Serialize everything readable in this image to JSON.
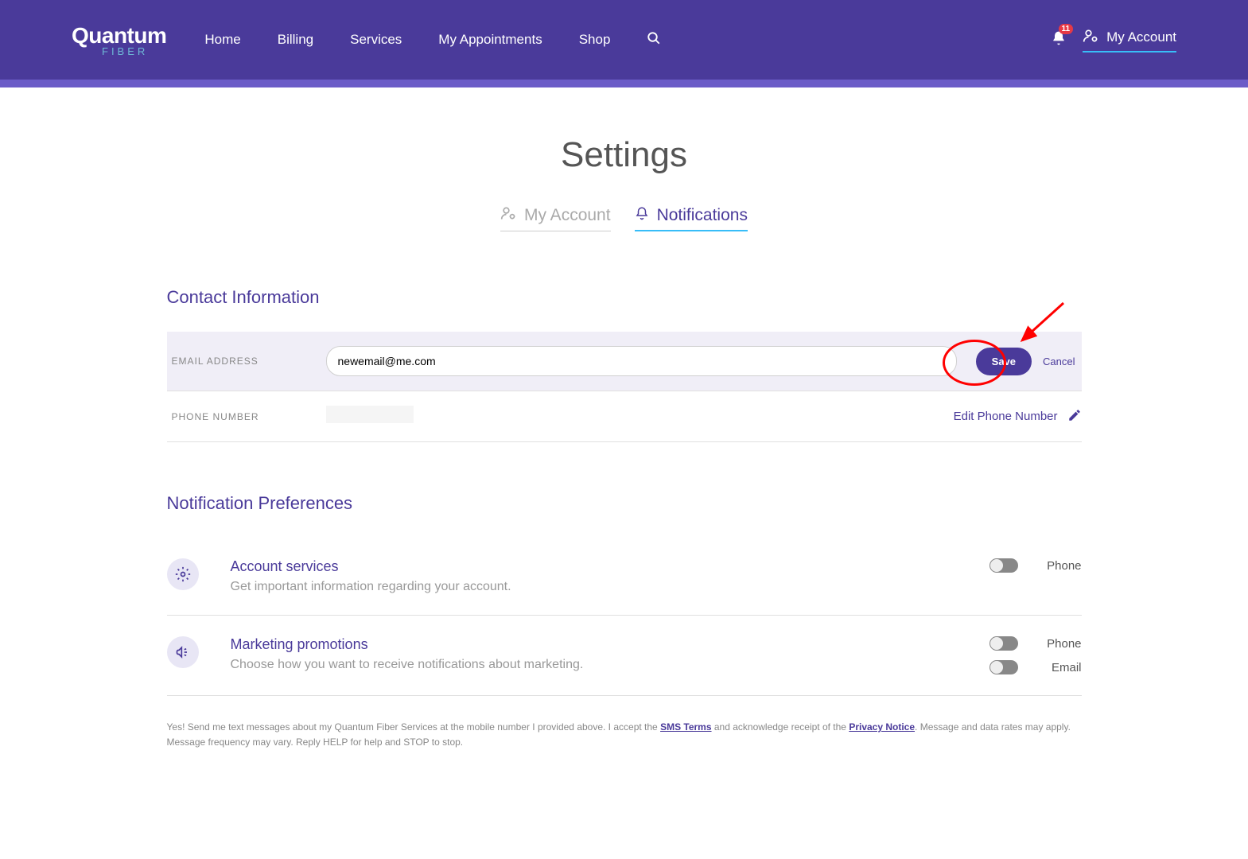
{
  "header": {
    "logo_main": "Quantum",
    "logo_sub": "FIBER",
    "nav": [
      "Home",
      "Billing",
      "Services",
      "My Appointments",
      "Shop"
    ],
    "notification_count": "11",
    "account_link": "My Account"
  },
  "page": {
    "title": "Settings",
    "tabs": {
      "my_account": "My Account",
      "notifications": "Notifications"
    }
  },
  "contact": {
    "section_title": "Contact Information",
    "email_label": "EMAIL ADDRESS",
    "email_value": "newemail@me.com",
    "save_label": "Save",
    "cancel_label": "Cancel",
    "phone_label": "PHONE NUMBER",
    "phone_value": "",
    "edit_phone_label": "Edit Phone Number"
  },
  "prefs": {
    "section_title": "Notification Preferences",
    "items": [
      {
        "title": "Account services",
        "desc": "Get important information regarding your account.",
        "controls": [
          {
            "label": "Phone"
          }
        ]
      },
      {
        "title": "Marketing promotions",
        "desc": "Choose how you want to receive notifications about marketing.",
        "controls": [
          {
            "label": "Phone"
          },
          {
            "label": "Email"
          }
        ]
      }
    ]
  },
  "legal": {
    "prefix": "Yes! Send me text messages about my Quantum Fiber Services at the mobile number I provided above. I accept the ",
    "sms_link": "SMS Terms",
    "middle": " and acknowledge receipt of the ",
    "privacy_link": "Privacy Notice",
    "suffix": ". Message and data rates may apply. Message frequency may vary. Reply HELP for help and STOP to stop."
  }
}
